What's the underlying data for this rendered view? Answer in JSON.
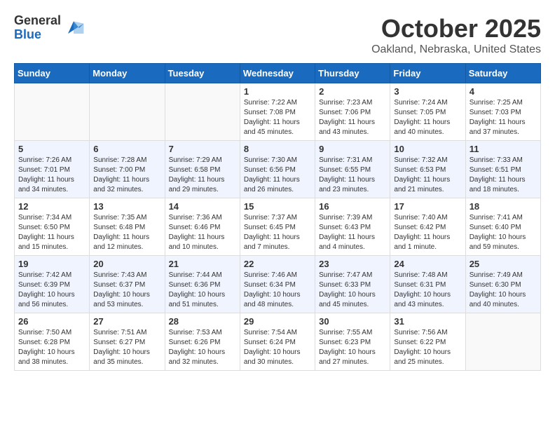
{
  "logo": {
    "general": "General",
    "blue": "Blue"
  },
  "title": "October 2025",
  "location": "Oakland, Nebraska, United States",
  "days_of_week": [
    "Sunday",
    "Monday",
    "Tuesday",
    "Wednesday",
    "Thursday",
    "Friday",
    "Saturday"
  ],
  "weeks": [
    [
      {
        "day": "",
        "info": ""
      },
      {
        "day": "",
        "info": ""
      },
      {
        "day": "",
        "info": ""
      },
      {
        "day": "1",
        "info": "Sunrise: 7:22 AM\nSunset: 7:08 PM\nDaylight: 11 hours and 45 minutes."
      },
      {
        "day": "2",
        "info": "Sunrise: 7:23 AM\nSunset: 7:06 PM\nDaylight: 11 hours and 43 minutes."
      },
      {
        "day": "3",
        "info": "Sunrise: 7:24 AM\nSunset: 7:05 PM\nDaylight: 11 hours and 40 minutes."
      },
      {
        "day": "4",
        "info": "Sunrise: 7:25 AM\nSunset: 7:03 PM\nDaylight: 11 hours and 37 minutes."
      }
    ],
    [
      {
        "day": "5",
        "info": "Sunrise: 7:26 AM\nSunset: 7:01 PM\nDaylight: 11 hours and 34 minutes."
      },
      {
        "day": "6",
        "info": "Sunrise: 7:28 AM\nSunset: 7:00 PM\nDaylight: 11 hours and 32 minutes."
      },
      {
        "day": "7",
        "info": "Sunrise: 7:29 AM\nSunset: 6:58 PM\nDaylight: 11 hours and 29 minutes."
      },
      {
        "day": "8",
        "info": "Sunrise: 7:30 AM\nSunset: 6:56 PM\nDaylight: 11 hours and 26 minutes."
      },
      {
        "day": "9",
        "info": "Sunrise: 7:31 AM\nSunset: 6:55 PM\nDaylight: 11 hours and 23 minutes."
      },
      {
        "day": "10",
        "info": "Sunrise: 7:32 AM\nSunset: 6:53 PM\nDaylight: 11 hours and 21 minutes."
      },
      {
        "day": "11",
        "info": "Sunrise: 7:33 AM\nSunset: 6:51 PM\nDaylight: 11 hours and 18 minutes."
      }
    ],
    [
      {
        "day": "12",
        "info": "Sunrise: 7:34 AM\nSunset: 6:50 PM\nDaylight: 11 hours and 15 minutes."
      },
      {
        "day": "13",
        "info": "Sunrise: 7:35 AM\nSunset: 6:48 PM\nDaylight: 11 hours and 12 minutes."
      },
      {
        "day": "14",
        "info": "Sunrise: 7:36 AM\nSunset: 6:46 PM\nDaylight: 11 hours and 10 minutes."
      },
      {
        "day": "15",
        "info": "Sunrise: 7:37 AM\nSunset: 6:45 PM\nDaylight: 11 hours and 7 minutes."
      },
      {
        "day": "16",
        "info": "Sunrise: 7:39 AM\nSunset: 6:43 PM\nDaylight: 11 hours and 4 minutes."
      },
      {
        "day": "17",
        "info": "Sunrise: 7:40 AM\nSunset: 6:42 PM\nDaylight: 11 hours and 1 minute."
      },
      {
        "day": "18",
        "info": "Sunrise: 7:41 AM\nSunset: 6:40 PM\nDaylight: 10 hours and 59 minutes."
      }
    ],
    [
      {
        "day": "19",
        "info": "Sunrise: 7:42 AM\nSunset: 6:39 PM\nDaylight: 10 hours and 56 minutes."
      },
      {
        "day": "20",
        "info": "Sunrise: 7:43 AM\nSunset: 6:37 PM\nDaylight: 10 hours and 53 minutes."
      },
      {
        "day": "21",
        "info": "Sunrise: 7:44 AM\nSunset: 6:36 PM\nDaylight: 10 hours and 51 minutes."
      },
      {
        "day": "22",
        "info": "Sunrise: 7:46 AM\nSunset: 6:34 PM\nDaylight: 10 hours and 48 minutes."
      },
      {
        "day": "23",
        "info": "Sunrise: 7:47 AM\nSunset: 6:33 PM\nDaylight: 10 hours and 45 minutes."
      },
      {
        "day": "24",
        "info": "Sunrise: 7:48 AM\nSunset: 6:31 PM\nDaylight: 10 hours and 43 minutes."
      },
      {
        "day": "25",
        "info": "Sunrise: 7:49 AM\nSunset: 6:30 PM\nDaylight: 10 hours and 40 minutes."
      }
    ],
    [
      {
        "day": "26",
        "info": "Sunrise: 7:50 AM\nSunset: 6:28 PM\nDaylight: 10 hours and 38 minutes."
      },
      {
        "day": "27",
        "info": "Sunrise: 7:51 AM\nSunset: 6:27 PM\nDaylight: 10 hours and 35 minutes."
      },
      {
        "day": "28",
        "info": "Sunrise: 7:53 AM\nSunset: 6:26 PM\nDaylight: 10 hours and 32 minutes."
      },
      {
        "day": "29",
        "info": "Sunrise: 7:54 AM\nSunset: 6:24 PM\nDaylight: 10 hours and 30 minutes."
      },
      {
        "day": "30",
        "info": "Sunrise: 7:55 AM\nSunset: 6:23 PM\nDaylight: 10 hours and 27 minutes."
      },
      {
        "day": "31",
        "info": "Sunrise: 7:56 AM\nSunset: 6:22 PM\nDaylight: 10 hours and 25 minutes."
      },
      {
        "day": "",
        "info": ""
      }
    ]
  ]
}
